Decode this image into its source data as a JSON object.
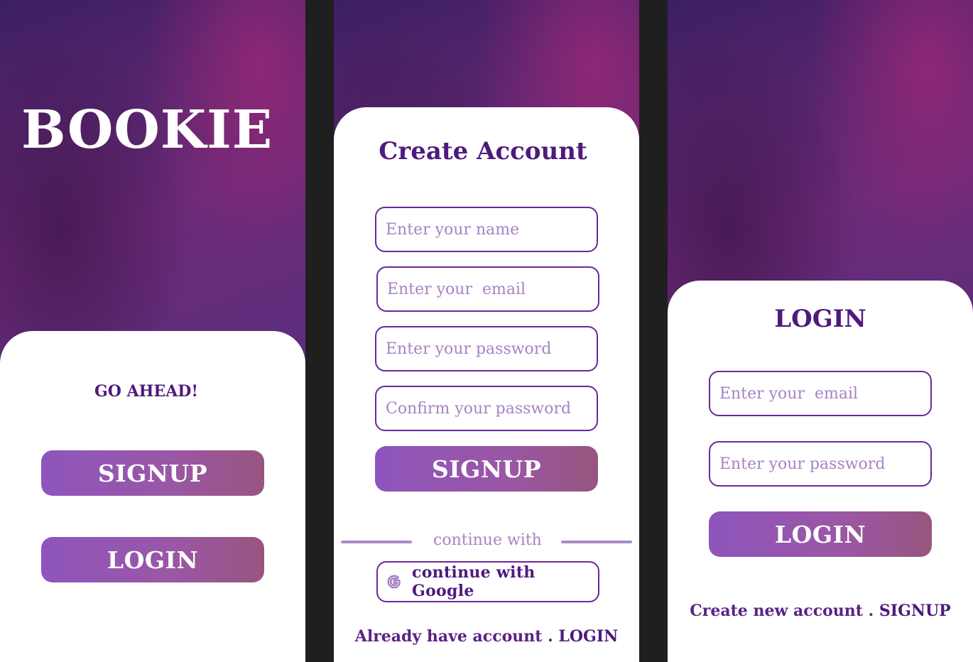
{
  "welcome": {
    "brand": "BOOKIE",
    "tagline": "GO AHEAD!",
    "signup_label": "SIGNUP",
    "login_label": "LOGIN"
  },
  "signup": {
    "title": "Create Account",
    "name_placeholder": "Enter your name",
    "email_placeholder": "Enter your  email",
    "password_placeholder": "Enter your password",
    "confirm_placeholder": "Confirm your password",
    "signup_label": "SIGNUP",
    "divider_text": "continue with",
    "google_label": "continue with  Google",
    "footer_text": "Already have account . ",
    "footer_link": "LOGIN"
  },
  "login": {
    "title": "LOGIN",
    "email_placeholder": "Enter your  email",
    "password_placeholder": "Enter your password",
    "login_label": "LOGIN",
    "footer_text": "Create new account . ",
    "footer_link": "SIGNUP"
  },
  "colors": {
    "accent": "#4e1a7c",
    "button_start": "#8e55bd",
    "button_end": "#98557e",
    "placeholder": "#a683c3"
  },
  "icons": {
    "google": "google-icon"
  }
}
